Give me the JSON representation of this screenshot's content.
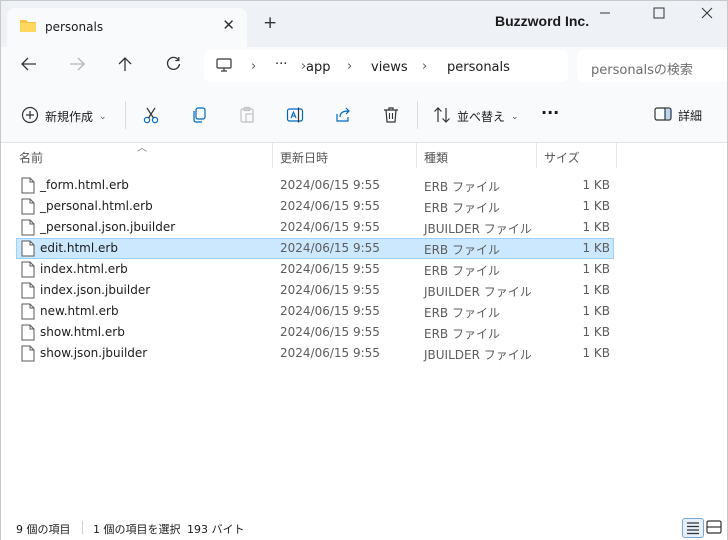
{
  "window": {
    "tab_title": "personals",
    "new_tab_label": "+",
    "watermark": "Buzzword Inc."
  },
  "nav": {
    "path": [
      "app",
      "views",
      "personals"
    ],
    "overflow": "···",
    "search_placeholder": "personalsの検索"
  },
  "toolbar": {
    "new_label": "新規作成",
    "sort_label": "並べ替え",
    "more_label": "···",
    "details_label": "詳細"
  },
  "columns": {
    "name": "名前",
    "date": "更新日時",
    "type": "種類",
    "size": "サイズ"
  },
  "files": [
    {
      "name": "_form.html.erb",
      "date": "2024/06/15 9:55",
      "type": "ERB ファイル",
      "size": "1 KB"
    },
    {
      "name": "_personal.html.erb",
      "date": "2024/06/15 9:55",
      "type": "ERB ファイル",
      "size": "1 KB"
    },
    {
      "name": "_personal.json.jbuilder",
      "date": "2024/06/15 9:55",
      "type": "JBUILDER ファイル",
      "size": "1 KB"
    },
    {
      "name": "edit.html.erb",
      "date": "2024/06/15 9:55",
      "type": "ERB ファイル",
      "size": "1 KB"
    },
    {
      "name": "index.html.erb",
      "date": "2024/06/15 9:55",
      "type": "ERB ファイル",
      "size": "1 KB"
    },
    {
      "name": "index.json.jbuilder",
      "date": "2024/06/15 9:55",
      "type": "JBUILDER ファイル",
      "size": "1 KB"
    },
    {
      "name": "new.html.erb",
      "date": "2024/06/15 9:55",
      "type": "ERB ファイル",
      "size": "1 KB"
    },
    {
      "name": "show.html.erb",
      "date": "2024/06/15 9:55",
      "type": "ERB ファイル",
      "size": "1 KB"
    },
    {
      "name": "show.json.jbuilder",
      "date": "2024/06/15 9:55",
      "type": "JBUILDER ファイル",
      "size": "1 KB"
    }
  ],
  "selected_file": "edit.html.erb",
  "status": {
    "item_count": "9 個の項目",
    "selection": "1 個の項目を選択",
    "selection_size": "193 バイト"
  },
  "colors": {
    "selection_bg": "#cce8ff",
    "selection_border": "#99d1ff",
    "folder": "#f4c542",
    "accent": "#0067c0"
  }
}
